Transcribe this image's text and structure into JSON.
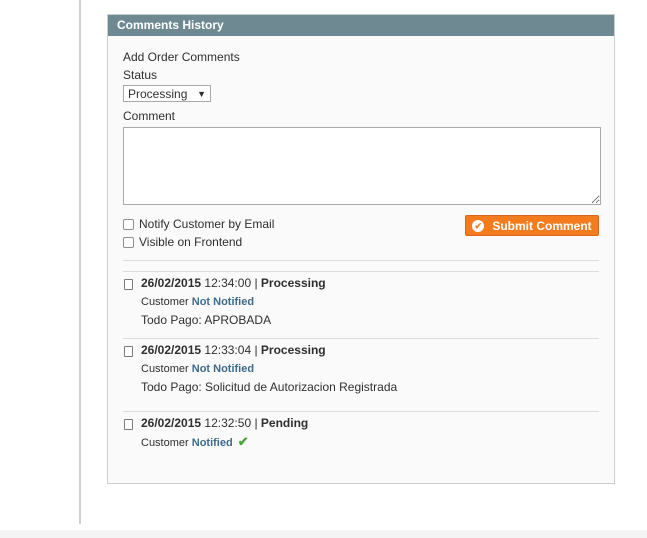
{
  "header": {
    "title": "Comments History"
  },
  "form": {
    "add_label": "Add Order Comments",
    "status_label": "Status",
    "status_value": "Processing",
    "comment_label": "Comment",
    "notify_label": "Notify Customer by Email",
    "visible_label": "Visible on Frontend",
    "submit_label": "Submit Comment"
  },
  "history": [
    {
      "date": "26/02/2015",
      "time": "12:34:00",
      "status": "Processing",
      "customer_label": "Customer",
      "customer_state": "Not Notified",
      "note": "Todo Pago: APROBADA"
    },
    {
      "date": "26/02/2015",
      "time": "12:33:04",
      "status": "Processing",
      "customer_label": "Customer",
      "customer_state": "Not Notified",
      "note": "Todo Pago: Solicitud de Autorizacion Registrada"
    },
    {
      "date": "26/02/2015",
      "time": "12:32:50",
      "status": "Pending",
      "customer_label": "Customer",
      "customer_state": "Notified",
      "note": ""
    }
  ],
  "colors": {
    "header": "#6f8992",
    "submit": "#f47c1f",
    "link": "#3e6a8a",
    "check": "#4aa43a"
  }
}
